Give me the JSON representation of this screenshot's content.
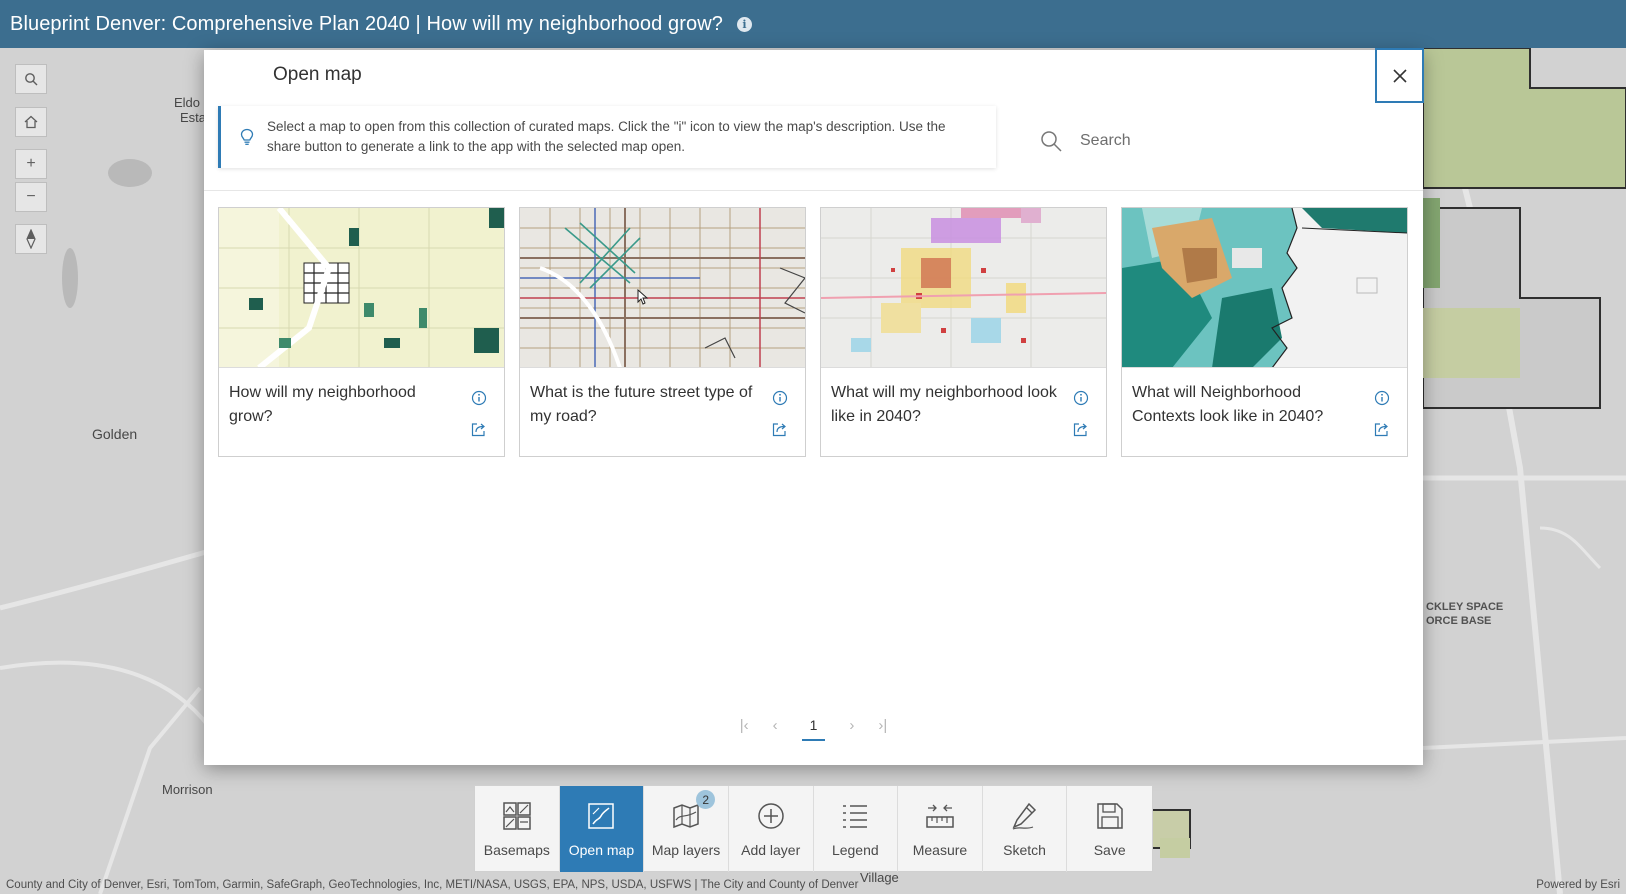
{
  "header": {
    "title": "Blueprint Denver: Comprehensive Plan 2040 | How will my neighborhood grow?"
  },
  "map": {
    "labels": [
      "Eldo",
      "Esta",
      "Golden",
      "Morrison",
      "Village",
      "CKLEY SPACE",
      "ORCE BASE"
    ],
    "controls": [
      "search-icon",
      "home-icon",
      "zoom-in-icon",
      "zoom-out-icon",
      "compass-icon"
    ]
  },
  "modal": {
    "title": "Open map",
    "notice": "Select a map to open from this collection of curated maps. Click the \"i\" icon to view the map's description. Use the share button to generate a link to the app with the selected map open.",
    "search_placeholder": "Search",
    "cards": [
      {
        "title": "How will my neighborhood grow?"
      },
      {
        "title": "What is the future street type of my road?"
      },
      {
        "title": "What will my neighborhood look like in 2040?"
      },
      {
        "title": "What will Neighborhood Contexts look like in 2040?"
      }
    ],
    "pagination": {
      "current": "1",
      "first": "|‹",
      "prev": "‹",
      "next": "›",
      "last": "›|"
    }
  },
  "toolbar": {
    "items": [
      {
        "label": "Basemaps",
        "icon": "basemaps-icon"
      },
      {
        "label": "Open map",
        "icon": "open-map-icon",
        "active": true
      },
      {
        "label": "Map layers",
        "icon": "map-layers-icon",
        "badge": "2"
      },
      {
        "label": "Add layer",
        "icon": "add-layer-icon"
      },
      {
        "label": "Legend",
        "icon": "legend-icon"
      },
      {
        "label": "Measure",
        "icon": "measure-icon"
      },
      {
        "label": "Sketch",
        "icon": "sketch-icon"
      },
      {
        "label": "Save",
        "icon": "save-icon"
      }
    ]
  },
  "attribution": "County and City of Denver, Esri, TomTom, Garmin, SafeGraph, GeoTechnologies, Inc, METI/NASA, USGS, EPA, NPS, USDA, USFWS | The City and County of Denver",
  "powered_by": "Powered by Esri",
  "colors": {
    "header": "#3c6e8f",
    "accent": "#2e7bb5",
    "map_green": "#c9d8a4"
  }
}
